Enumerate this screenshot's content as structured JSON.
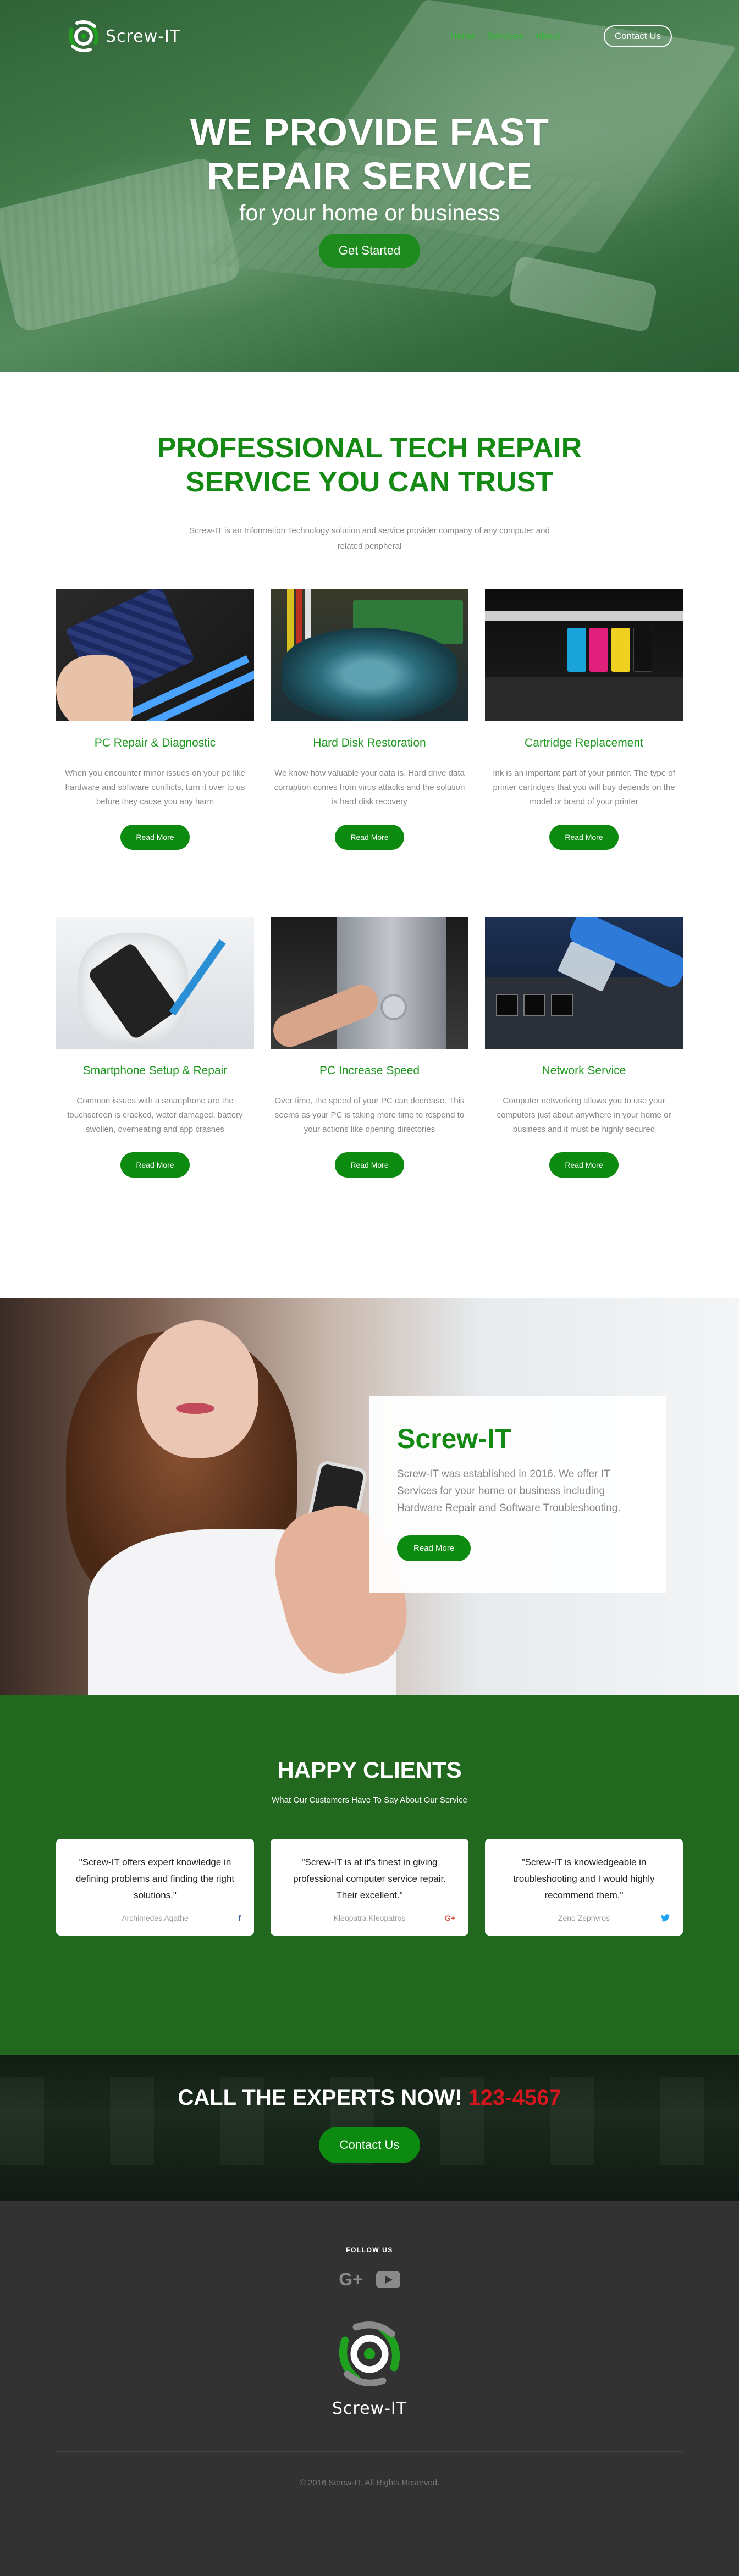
{
  "brand": {
    "name": "Screw-IT",
    "logo_text": "Screw-IT",
    "accent": "#148a14",
    "hero_tint": "#2e7d32"
  },
  "nav": {
    "links": [
      "Home",
      "Services",
      "About"
    ],
    "contact_label": "Contact Us"
  },
  "hero": {
    "headline_line1": "WE PROVIDE FAST",
    "headline_line2": "REPAIR SERVICE",
    "subheadline": "for your home or business",
    "cta_label": "Get Started"
  },
  "services": {
    "heading_line1": "PROFESSIONAL TECH REPAIR",
    "heading_line2": "SERVICE YOU CAN TRUST",
    "intro": "Screw-IT is an Information Technology solution and service provider company of any computer and related peripheral",
    "read_more_label": "Read More",
    "items": [
      {
        "title": "PC Repair & Diagnostic",
        "desc": "When you encounter minor issues on your pc like hardware and software conflicts, turn it over to us before they cause you any harm",
        "image": "motherboard-gpu-photo"
      },
      {
        "title": "Hard Disk Restoration",
        "desc": "We know how valuable your data is. Hard drive data corruption comes from virus attacks and the solution is hard disk recovery",
        "image": "hard-disk-platter-photo"
      },
      {
        "title": "Cartridge Replacement",
        "desc": "Ink is an important part of your printer. The type of printer cartridges that you will buy depends on the model or brand of your printer",
        "image": "printer-cartridges-photo"
      },
      {
        "title": "Smartphone Setup & Repair",
        "desc": "Common issues with a smartphone are the touchscreen is cracked, water damaged, battery swollen, overheating and app crashes",
        "image": "smartphone-repair-photo"
      },
      {
        "title": "PC Increase Speed",
        "desc": "Over time, the speed of your PC can decrease. This seems as your PC is taking more time to respond to your actions like opening directories",
        "image": "pc-power-button-photo"
      },
      {
        "title": "Network Service",
        "desc": "Computer networking allows you to use your computers just about anywhere in your home or business and it must be highly secured",
        "image": "network-cable-photo"
      }
    ]
  },
  "about": {
    "title": "Screw-IT",
    "text": "Screw-IT was established in 2016. We offer IT Services for your home or business including Hardware Repair and Software Troubleshooting.",
    "button_label": "Read More"
  },
  "testimonials": {
    "heading": "HAPPY CLIENTS",
    "tagline": "What Our Customers Have To Say About Our Service",
    "items": [
      {
        "quote": "\"Screw-IT offers expert knowledge in defining problems and finding the right solutions.\"",
        "name": "Archimedes Agathe",
        "icon": "facebook-icon",
        "icon_glyph": "f",
        "color": "#3b5998"
      },
      {
        "quote": "\"Screw-IT is at it's finest in giving professional computer service repair. Their excellent.\"",
        "name": "Kleopatra Kleopatros",
        "icon": "google-plus-icon",
        "icon_glyph": "G+",
        "color": "#dd4b39"
      },
      {
        "quote": "\"Screw-IT is knowledgeable in troubleshooting and I would highly recommend them.\"",
        "name": "Zeno Zephyros",
        "icon": "twitter-icon",
        "icon_glyph": "🐦",
        "color": "#1da1f2"
      }
    ]
  },
  "cta": {
    "text": "CALL THE EXPERTS NOW!",
    "phone": "123-4567",
    "button_label": "Contact Us"
  },
  "footer": {
    "follow_label": "FOLLOW US",
    "social": [
      {
        "icon": "google-plus-icon",
        "glyph": "G+"
      },
      {
        "icon": "youtube-icon"
      }
    ],
    "logo_text": "Screw-IT",
    "copyright": "© 2016 Screw-IT. All Rights Reserved."
  }
}
